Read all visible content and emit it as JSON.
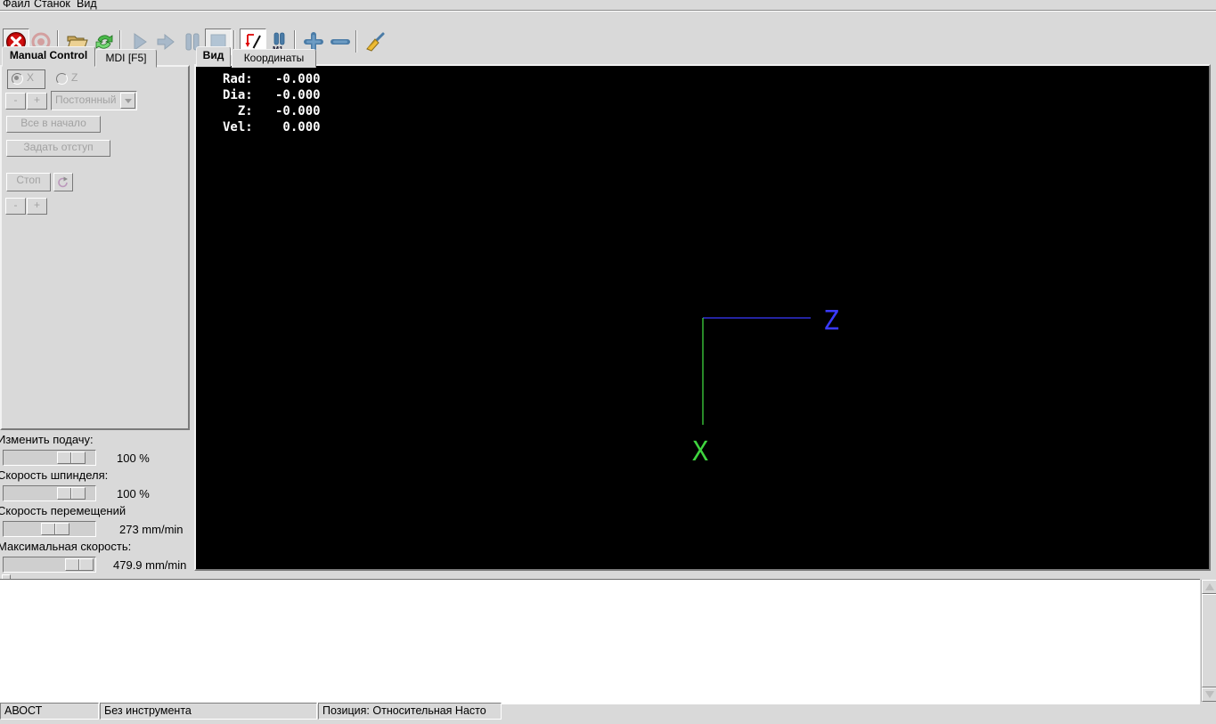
{
  "menu": {
    "items": [
      "Файл",
      "Станок",
      "Вид"
    ]
  },
  "toolbar": {
    "buttons": [
      "estop",
      "machine-power",
      "open-file",
      "reload-file",
      "run-program",
      "step-program",
      "pause-program",
      "stop-program",
      "toggle-plot",
      "optional-stop",
      "zoom-in",
      "zoom-out",
      "clear-plot"
    ],
    "m1_label": "M1"
  },
  "left_tabs": {
    "manual": "Manual Control",
    "mdi": "MDI [F5]"
  },
  "manual_panel": {
    "axis_x": "X",
    "axis_z": "Z",
    "jog_minus": "-",
    "jog_plus": "+",
    "increment": "Постоянный",
    "home_all": "Все в начало",
    "touch_off": "Задать отступ",
    "spindle_stop": "Стоп",
    "spindle_minus": "-",
    "spindle_plus": "+"
  },
  "sliders": [
    {
      "label": "Изменить подачу:",
      "value": "100 %"
    },
    {
      "label": "Скорость шпинделя:",
      "value": "100 %"
    },
    {
      "label": "Скорость перемещений",
      "value": "273 mm/min"
    },
    {
      "label": "Максимальная скорость:",
      "value": "479.9 mm/min"
    }
  ],
  "view_tabs": {
    "preview": "Вид",
    "dro": "Координаты"
  },
  "dro": {
    "lines": [
      "Rad:   -0.000",
      "Dia:   -0.000",
      "  Z:   -0.000",
      "Vel:    0.000"
    ]
  },
  "axes": {
    "z_label": "Z",
    "x_label": "X",
    "z_color": "#3a3aff",
    "x_color": "#3fd43f"
  },
  "statusbar": {
    "machine_state": "АВОСТ",
    "tool": "Без инструмента",
    "position_mode": "Позиция: Относительная Насто"
  }
}
